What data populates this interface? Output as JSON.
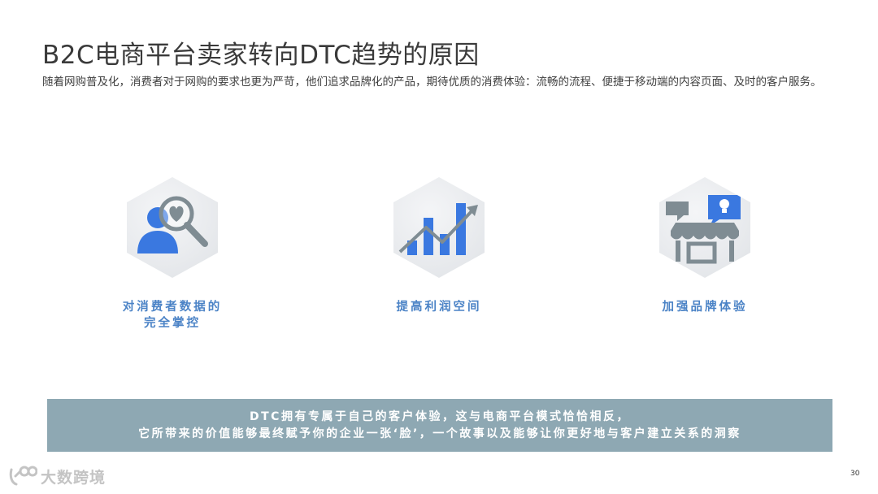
{
  "title": "B2C电商平台卖家转向DTC趋势的原因",
  "subtitle": "随着网购普及化，消费者对于网购的要求也更为严苛，他们追求品牌化的产品，期待优质的消费体验：流畅的流程、便捷于移动端的内容页面、及时的客户服务。",
  "features": [
    {
      "label_line1": "对消费者数据的",
      "label_line2": "完全掌控",
      "icon": "user-magnifier-icon"
    },
    {
      "label_line1": "提高利润空间",
      "label_line2": "",
      "icon": "growth-chart-icon"
    },
    {
      "label_line1": "加强品牌体验",
      "label_line2": "",
      "icon": "storefront-icon"
    }
  ],
  "banner": {
    "line1": "DTC拥有专属于自己的客户体验，这与电商平台模式恰恰相反，",
    "line2": "它所带来的价值能够最终赋予你的企业一张‘脸’，一个故事以及能够让你更好地与客户建立关系的洞察"
  },
  "footer": {
    "logo_text": "大数跨境",
    "page_number": "30"
  },
  "colors": {
    "accent_blue": "#4b83c6",
    "icon_blue": "#3a78e0",
    "banner_bg": "#8ea8b3",
    "icon_gray": "#7f8c93"
  }
}
